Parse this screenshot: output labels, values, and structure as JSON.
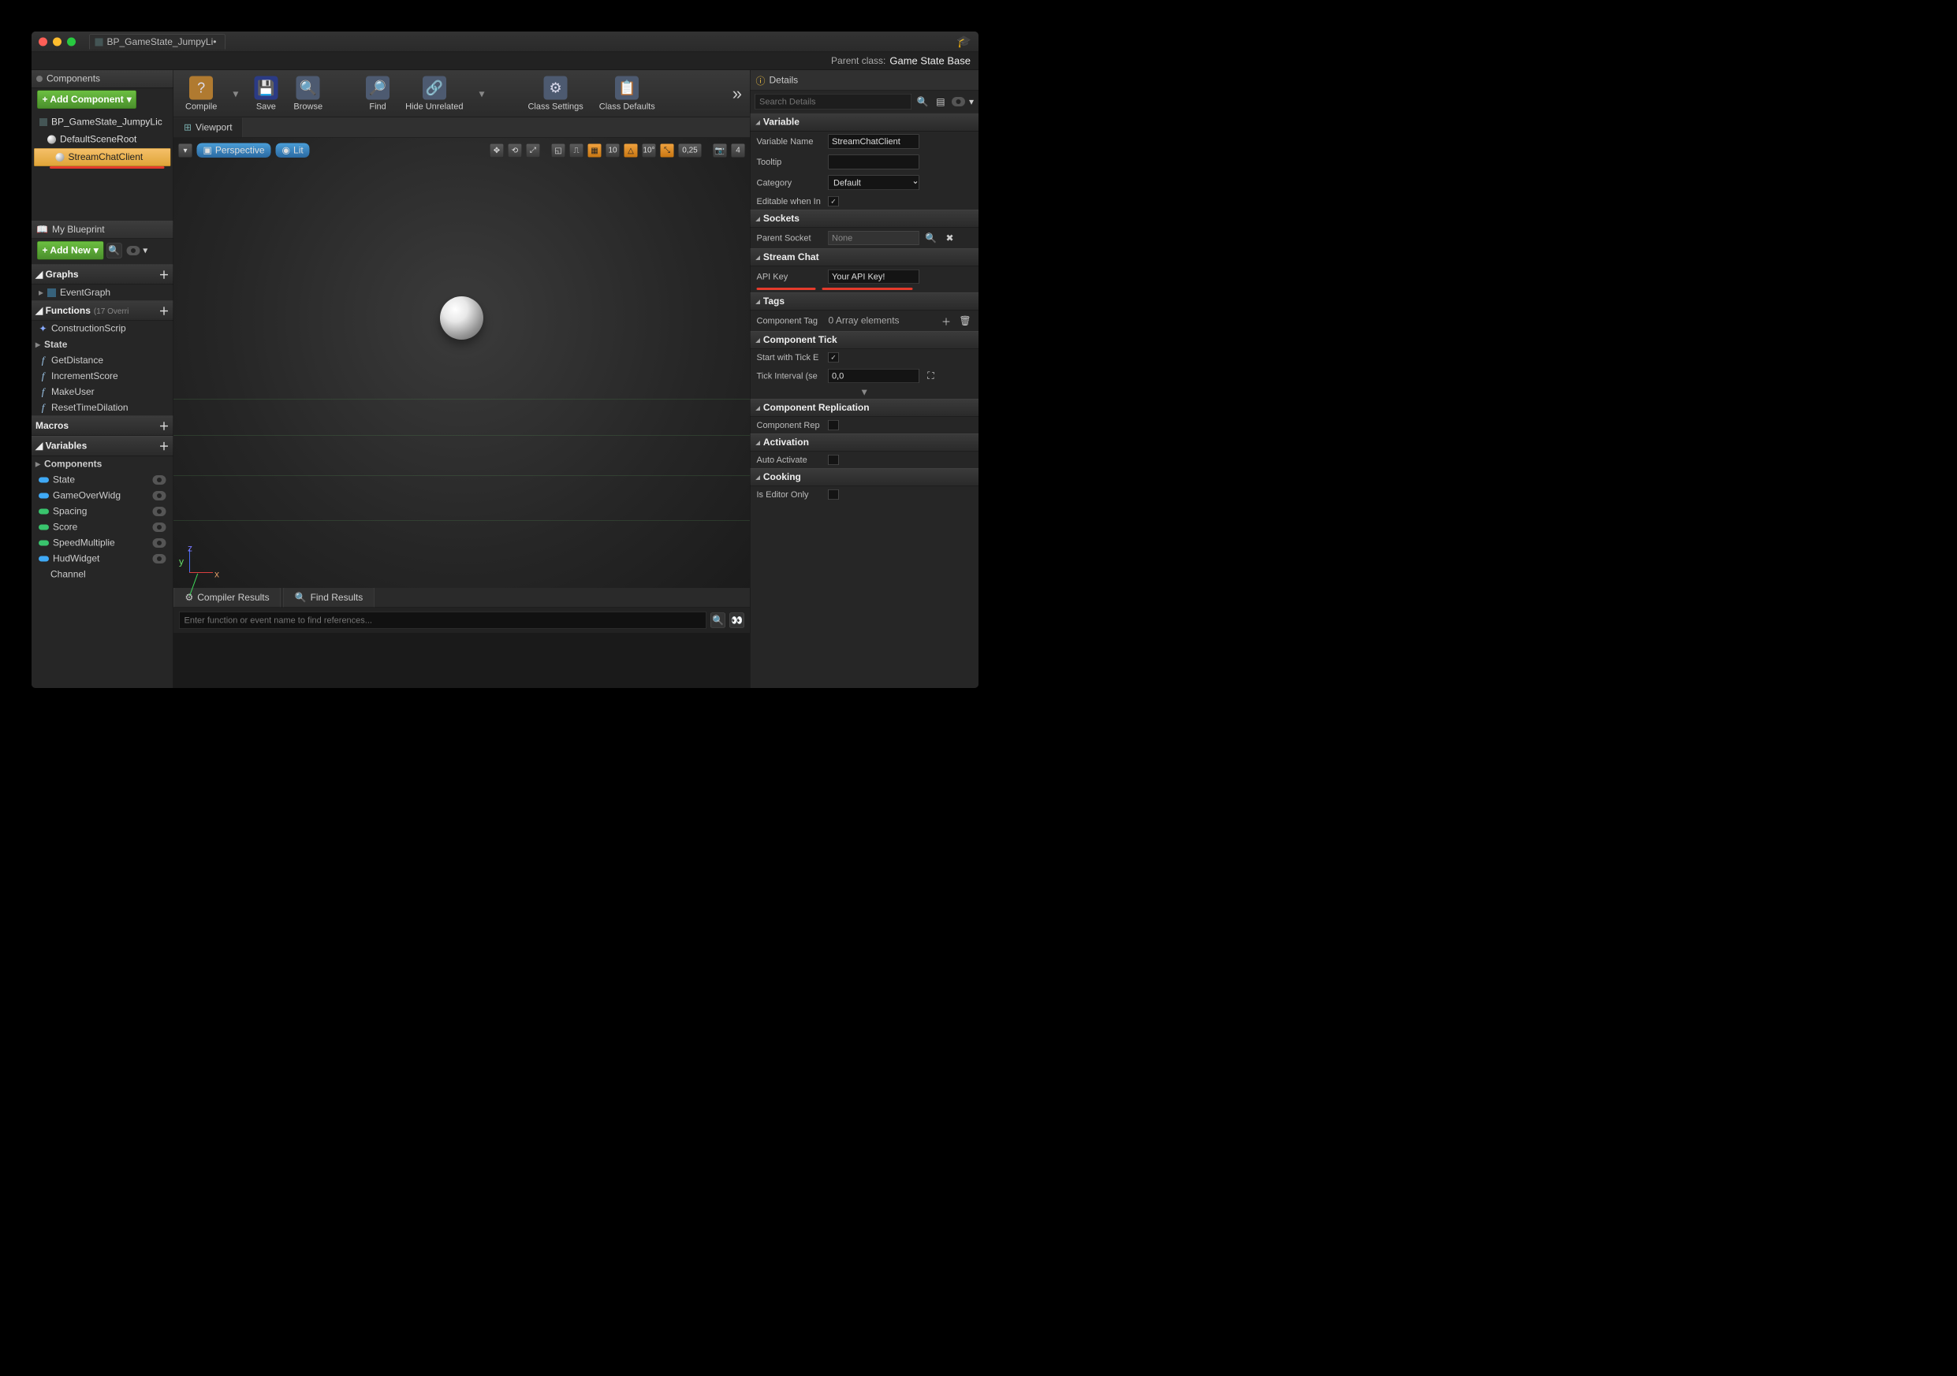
{
  "tab_title": "BP_GameState_JumpyLi•",
  "parent_class_label": "Parent class:",
  "parent_class_value": "Game State Base",
  "components_panel": {
    "title": "Components",
    "add_button": "+ Add Component",
    "items": [
      "BP_GameState_JumpyLic",
      "DefaultSceneRoot",
      "StreamChatClient"
    ],
    "selected_index": 2
  },
  "myblueprint": {
    "title": "My Blueprint",
    "add_button": "+ Add New",
    "graphs": {
      "label": "Graphs",
      "items": [
        "EventGraph"
      ]
    },
    "functions": {
      "label": "Functions",
      "override_hint": "(17 Overri",
      "items": [
        "ConstructionScrip",
        "State",
        "GetDistance",
        "IncrementScore",
        "MakeUser",
        "ResetTimeDilation"
      ]
    },
    "macros": {
      "label": "Macros"
    },
    "variables": {
      "label": "Variables",
      "components_label": "Components",
      "items": [
        "State",
        "GameOverWidg",
        "Spacing",
        "Score",
        "SpeedMultiplie",
        "HudWidget",
        "Channel"
      ]
    }
  },
  "toolbar": {
    "compile": "Compile",
    "save": "Save",
    "browse": "Browse",
    "find": "Find",
    "hide_unrelated": "Hide Unrelated",
    "class_settings": "Class Settings",
    "class_defaults": "Class Defaults"
  },
  "viewport": {
    "tab": "Viewport",
    "perspective": "Perspective",
    "lit": "Lit",
    "snap1": "10",
    "snap_angle": "10°",
    "snap_scale": "0,25",
    "cam_speed": "4"
  },
  "results": {
    "compiler": "Compiler Results",
    "find": "Find Results",
    "placeholder": "Enter function or event name to find references..."
  },
  "details": {
    "title": "Details",
    "search_placeholder": "Search Details",
    "variable": {
      "label": "Variable",
      "name_label": "Variable Name",
      "name_value": "StreamChatClient",
      "tooltip_label": "Tooltip",
      "tooltip_value": "",
      "category_label": "Category",
      "category_value": "Default",
      "editable_label": "Editable when In",
      "editable_checked": true
    },
    "sockets": {
      "label": "Sockets",
      "parent_label": "Parent Socket",
      "parent_value": "None"
    },
    "streamchat": {
      "label": "Stream Chat",
      "apikey_label": "API Key",
      "apikey_value": "Your API Key!"
    },
    "tags": {
      "label": "Tags",
      "component_tags_label": "Component Tag",
      "value": "0 Array elements"
    },
    "tick": {
      "label": "Component Tick",
      "start_label": "Start with Tick E",
      "start_checked": true,
      "interval_label": "Tick Interval (se",
      "interval_value": "0,0"
    },
    "replication": {
      "label": "Component Replication",
      "row_label": "Component Rep"
    },
    "activation": {
      "label": "Activation",
      "row_label": "Auto Activate"
    },
    "cooking": {
      "label": "Cooking",
      "row_label": "Is Editor Only"
    }
  }
}
